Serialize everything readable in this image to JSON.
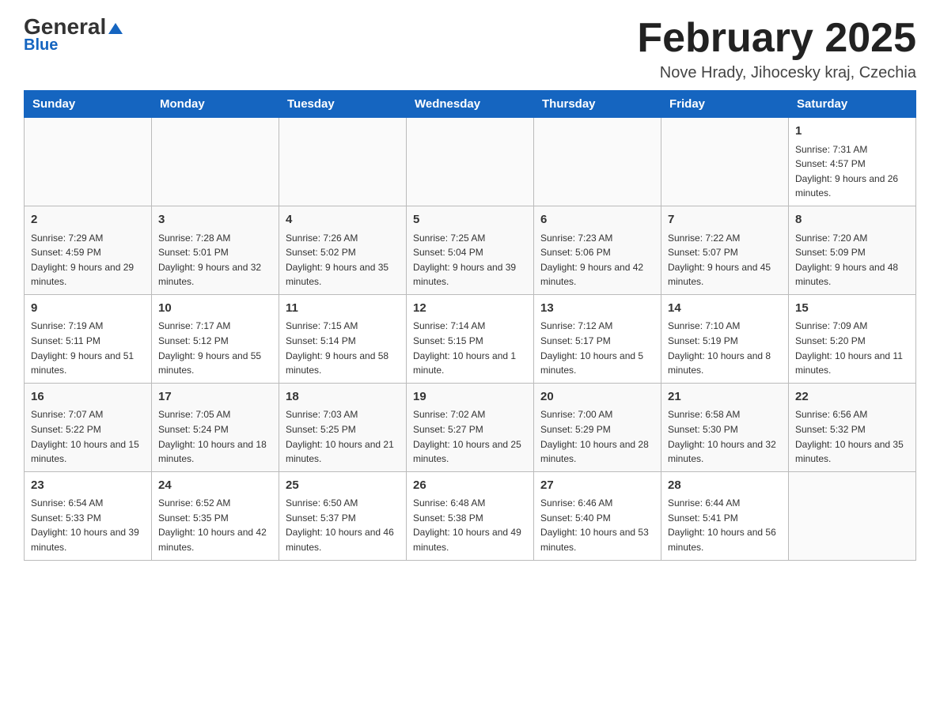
{
  "header": {
    "logo_general": "General",
    "logo_blue": "Blue",
    "month_title": "February 2025",
    "location": "Nove Hrady, Jihocesky kraj, Czechia"
  },
  "days_of_week": [
    "Sunday",
    "Monday",
    "Tuesday",
    "Wednesday",
    "Thursday",
    "Friday",
    "Saturday"
  ],
  "weeks": [
    {
      "days": [
        {
          "num": "",
          "info": ""
        },
        {
          "num": "",
          "info": ""
        },
        {
          "num": "",
          "info": ""
        },
        {
          "num": "",
          "info": ""
        },
        {
          "num": "",
          "info": ""
        },
        {
          "num": "",
          "info": ""
        },
        {
          "num": "1",
          "info": "Sunrise: 7:31 AM\nSunset: 4:57 PM\nDaylight: 9 hours and 26 minutes."
        }
      ]
    },
    {
      "days": [
        {
          "num": "2",
          "info": "Sunrise: 7:29 AM\nSunset: 4:59 PM\nDaylight: 9 hours and 29 minutes."
        },
        {
          "num": "3",
          "info": "Sunrise: 7:28 AM\nSunset: 5:01 PM\nDaylight: 9 hours and 32 minutes."
        },
        {
          "num": "4",
          "info": "Sunrise: 7:26 AM\nSunset: 5:02 PM\nDaylight: 9 hours and 35 minutes."
        },
        {
          "num": "5",
          "info": "Sunrise: 7:25 AM\nSunset: 5:04 PM\nDaylight: 9 hours and 39 minutes."
        },
        {
          "num": "6",
          "info": "Sunrise: 7:23 AM\nSunset: 5:06 PM\nDaylight: 9 hours and 42 minutes."
        },
        {
          "num": "7",
          "info": "Sunrise: 7:22 AM\nSunset: 5:07 PM\nDaylight: 9 hours and 45 minutes."
        },
        {
          "num": "8",
          "info": "Sunrise: 7:20 AM\nSunset: 5:09 PM\nDaylight: 9 hours and 48 minutes."
        }
      ]
    },
    {
      "days": [
        {
          "num": "9",
          "info": "Sunrise: 7:19 AM\nSunset: 5:11 PM\nDaylight: 9 hours and 51 minutes."
        },
        {
          "num": "10",
          "info": "Sunrise: 7:17 AM\nSunset: 5:12 PM\nDaylight: 9 hours and 55 minutes."
        },
        {
          "num": "11",
          "info": "Sunrise: 7:15 AM\nSunset: 5:14 PM\nDaylight: 9 hours and 58 minutes."
        },
        {
          "num": "12",
          "info": "Sunrise: 7:14 AM\nSunset: 5:15 PM\nDaylight: 10 hours and 1 minute."
        },
        {
          "num": "13",
          "info": "Sunrise: 7:12 AM\nSunset: 5:17 PM\nDaylight: 10 hours and 5 minutes."
        },
        {
          "num": "14",
          "info": "Sunrise: 7:10 AM\nSunset: 5:19 PM\nDaylight: 10 hours and 8 minutes."
        },
        {
          "num": "15",
          "info": "Sunrise: 7:09 AM\nSunset: 5:20 PM\nDaylight: 10 hours and 11 minutes."
        }
      ]
    },
    {
      "days": [
        {
          "num": "16",
          "info": "Sunrise: 7:07 AM\nSunset: 5:22 PM\nDaylight: 10 hours and 15 minutes."
        },
        {
          "num": "17",
          "info": "Sunrise: 7:05 AM\nSunset: 5:24 PM\nDaylight: 10 hours and 18 minutes."
        },
        {
          "num": "18",
          "info": "Sunrise: 7:03 AM\nSunset: 5:25 PM\nDaylight: 10 hours and 21 minutes."
        },
        {
          "num": "19",
          "info": "Sunrise: 7:02 AM\nSunset: 5:27 PM\nDaylight: 10 hours and 25 minutes."
        },
        {
          "num": "20",
          "info": "Sunrise: 7:00 AM\nSunset: 5:29 PM\nDaylight: 10 hours and 28 minutes."
        },
        {
          "num": "21",
          "info": "Sunrise: 6:58 AM\nSunset: 5:30 PM\nDaylight: 10 hours and 32 minutes."
        },
        {
          "num": "22",
          "info": "Sunrise: 6:56 AM\nSunset: 5:32 PM\nDaylight: 10 hours and 35 minutes."
        }
      ]
    },
    {
      "days": [
        {
          "num": "23",
          "info": "Sunrise: 6:54 AM\nSunset: 5:33 PM\nDaylight: 10 hours and 39 minutes."
        },
        {
          "num": "24",
          "info": "Sunrise: 6:52 AM\nSunset: 5:35 PM\nDaylight: 10 hours and 42 minutes."
        },
        {
          "num": "25",
          "info": "Sunrise: 6:50 AM\nSunset: 5:37 PM\nDaylight: 10 hours and 46 minutes."
        },
        {
          "num": "26",
          "info": "Sunrise: 6:48 AM\nSunset: 5:38 PM\nDaylight: 10 hours and 49 minutes."
        },
        {
          "num": "27",
          "info": "Sunrise: 6:46 AM\nSunset: 5:40 PM\nDaylight: 10 hours and 53 minutes."
        },
        {
          "num": "28",
          "info": "Sunrise: 6:44 AM\nSunset: 5:41 PM\nDaylight: 10 hours and 56 minutes."
        },
        {
          "num": "",
          "info": ""
        }
      ]
    }
  ]
}
